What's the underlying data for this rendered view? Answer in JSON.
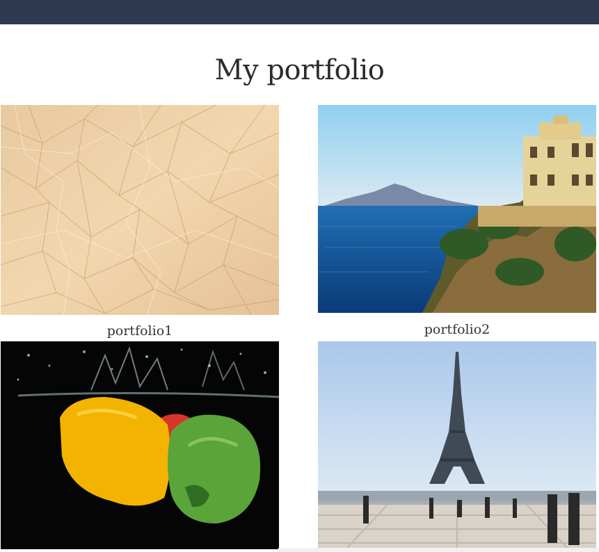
{
  "header": {
    "bar_color": "#2d3a50"
  },
  "page": {
    "title": "My portfolio"
  },
  "portfolio": {
    "items": [
      {
        "caption": "portfolio1",
        "image": "crumpled-paper-image"
      },
      {
        "caption": "portfolio2",
        "image": "coastal-villa-sea-image"
      },
      {
        "caption": "",
        "image": "peppers-splash-image"
      },
      {
        "caption": "",
        "image": "eiffel-tower-image"
      }
    ]
  }
}
